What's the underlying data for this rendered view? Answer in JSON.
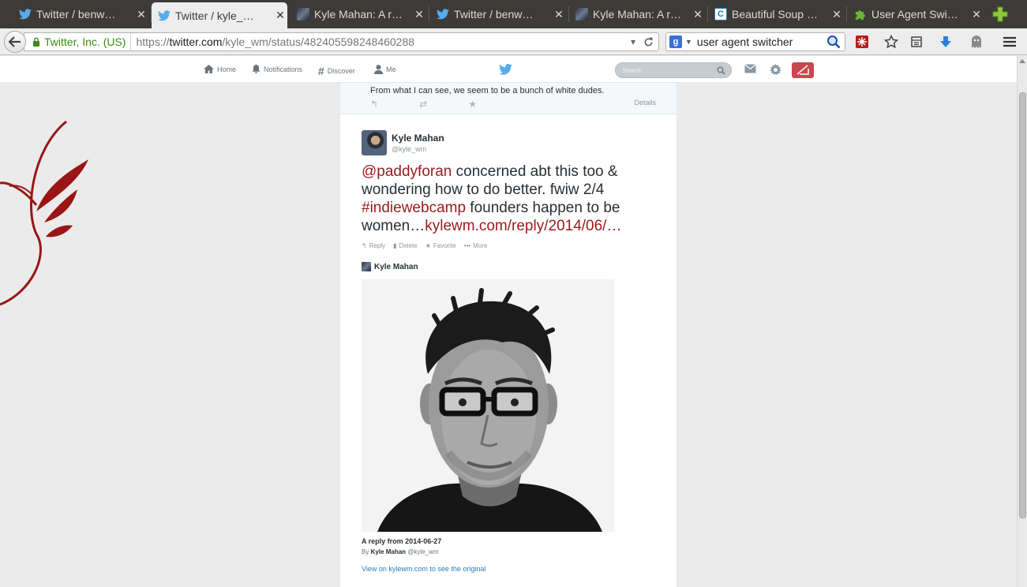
{
  "tabs": [
    {
      "title": "Twitter / benw…",
      "icon": "twitter-icon"
    },
    {
      "title": "Twitter / kyle_…",
      "icon": "twitter-icon",
      "active": true
    },
    {
      "title": "Kyle Mahan: A r…",
      "icon": "avatar-icon"
    },
    {
      "title": "Twitter / benw…",
      "icon": "twitter-icon"
    },
    {
      "title": "Kyle Mahan: A r…",
      "icon": "avatar-icon"
    },
    {
      "title": "Beautiful Soup …",
      "icon": "c-icon"
    },
    {
      "title": "User Agent Swi…",
      "icon": "puzzle-icon"
    }
  ],
  "tab_close": "✕",
  "navbar": {
    "identity": "Twitter, Inc. (US)",
    "url_scheme": "https://",
    "url_host": "twitter.com",
    "url_path": "/kyle_wm/status/482405598248460288",
    "search_value": "user agent switcher",
    "search_engine_letter": "g",
    "c_letter": "C"
  },
  "twitter_nav": {
    "home": "Home",
    "notifications": "Notifications",
    "discover": "Discover",
    "me": "Me",
    "search_placeholder": "Search"
  },
  "previous_tweet": {
    "text": "From what I can see, we seem to be a bunch of white dudes.",
    "details": "Details"
  },
  "tweet": {
    "fullname": "Kyle Mahan",
    "handle": "@kyle_wm",
    "text_mention": "@paddyforan",
    "text_part1": " concerned abt this too & wondering how to do better. fwiw 2/4 ",
    "text_hashtag": "#indiewebcamp",
    "text_part2": " founders happen to be women…",
    "text_link": "kylewm.com/reply/2014/06/…",
    "actions": {
      "reply": "Reply",
      "delete": "Delete",
      "favorite": "Favorite",
      "more": "More"
    }
  },
  "card": {
    "author": "Kyle Mahan",
    "caption": "A reply from 2014-06-27",
    "by_prefix": "By",
    "by_name": "Kyle Mahan",
    "by_handle": "@kyle_wm",
    "link_text": "View on kylewm.com to see the original"
  },
  "colors": {
    "accent_red": "#9a1a1a",
    "link_blue": "#2b7bb9",
    "compose_red": "#c9474d"
  }
}
